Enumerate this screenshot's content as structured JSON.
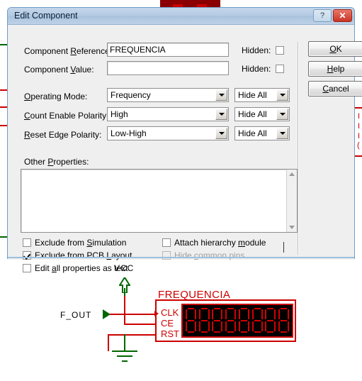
{
  "dialog": {
    "title": "Edit Component",
    "titlebar_buttons": [
      {
        "name": "help-titlebar",
        "glyph": "?"
      },
      {
        "name": "close-titlebar",
        "glyph": "✕"
      }
    ],
    "fields": {
      "component_reference": {
        "label_pre": "Component ",
        "label_mnemonic": "R",
        "label_post": "eference:",
        "value": "FREQUENCIA",
        "placeholder": "",
        "hidden_label": "Hidden:",
        "hidden_checked": false
      },
      "component_value": {
        "label_pre": "Component ",
        "label_mnemonic": "V",
        "label_post": "alue:",
        "value": "",
        "placeholder": "",
        "hidden_label": "Hidden:",
        "hidden_checked": false
      },
      "operating_mode": {
        "label_pre": "",
        "label_mnemonic": "O",
        "label_post": "perating Mode:",
        "value": "Frequency",
        "visibility": "Hide All"
      },
      "count_enable_polarity": {
        "label_pre": "",
        "label_mnemonic": "C",
        "label_post": "ount Enable Polarity:",
        "value": "High",
        "visibility": "Hide All"
      },
      "reset_edge_polarity": {
        "label_pre": "",
        "label_mnemonic": "R",
        "label_post": "eset Edge Polarity:",
        "value": "Low-High",
        "visibility": "Hide All"
      }
    },
    "other_properties": {
      "label_pre": "Other ",
      "label_mnemonic": "P",
      "label_post": "roperties:",
      "value": ""
    },
    "checkboxes": [
      {
        "name": "exclude-from-simulation",
        "pre": "Exclude from ",
        "mnemonic": "S",
        "post": "imulation",
        "checked": false,
        "disabled": false
      },
      {
        "name": "exclude-from-pcb-layout",
        "pre": "Exclude from PCB ",
        "mnemonic": "L",
        "post": "ayout",
        "checked": true,
        "disabled": false
      },
      {
        "name": "edit-all-properties-as-text",
        "pre": "Edit ",
        "mnemonic": "a",
        "post": "ll properties as text",
        "checked": false,
        "disabled": false
      },
      {
        "name": "attach-hierarchy-module",
        "pre": "Attach hierarchy ",
        "mnemonic": "m",
        "post": "odule",
        "checked": false,
        "disabled": false
      },
      {
        "name": "hide-common-pins",
        "pre": "Hide ",
        "mnemonic": "c",
        "post": "ommon pins",
        "checked": false,
        "disabled": true
      }
    ],
    "buttons": [
      {
        "name": "ok-button",
        "pre": "",
        "mnemonic": "O",
        "post": "K"
      },
      {
        "name": "help-button",
        "pre": "",
        "mnemonic": "H",
        "post": "elp"
      },
      {
        "name": "cancel-button",
        "pre": "",
        "mnemonic": "C",
        "post": "ancel"
      }
    ]
  },
  "schematic": {
    "power_label": "VCC",
    "net_label": "F_OUT",
    "component_title": "FREQUENCIA",
    "pins": [
      "CLK",
      "CE",
      "RST"
    ],
    "display_digit_count": 8,
    "colors": {
      "wire": "#cc0000",
      "power": "#006600",
      "component_outline": "#cc0000",
      "display_background": "#000000",
      "segment": "#d40000",
      "label": "#000000"
    }
  }
}
